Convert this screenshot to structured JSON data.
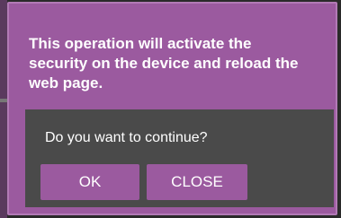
{
  "dialog": {
    "message": "This operation will activate the security on the device and reload the web page.",
    "question": "Do you want to continue?",
    "ok_label": "OK",
    "close_label": "CLOSE"
  },
  "colors": {
    "dialog_bg": "#9b5a9f",
    "panel_bg": "#4a4a4a",
    "text": "#ffffff"
  }
}
